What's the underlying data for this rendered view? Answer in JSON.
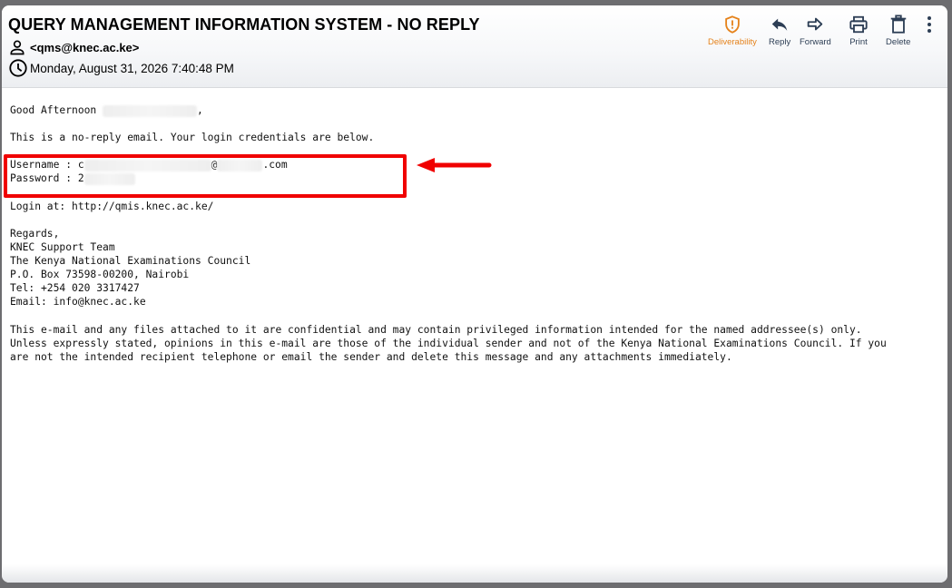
{
  "email": {
    "subject": "QUERY MANAGEMENT INFORMATION SYSTEM - NO REPLY",
    "sender": "<qms@knec.ac.ke>",
    "date": "Monday, August 31, 2026 7:40:48 PM"
  },
  "toolbar": {
    "deliverability": "Deliverability",
    "reply": "Reply",
    "forward": "Forward",
    "print": "Print",
    "delete": "Delete"
  },
  "body": {
    "greeting": "Good Afternoon",
    "greeting_suffix": ",",
    "intro": "This is a no-reply email. Your login credentials are below.",
    "username_label": "Username : c",
    "username_at": "@",
    "username_domain": ".com",
    "password_label": "Password : 2",
    "login": "Login at: http://qmis.knec.ac.ke/",
    "regards": "Regards,",
    "team": "KNEC Support Team",
    "org": "The Kenya National Examinations Council",
    "po_box": "P.O. Box 73598-00200, Nairobi",
    "tel": "Tel: +254 020 3317427",
    "email": "Email: info@knec.ac.ke",
    "disclaimer": "This e-mail and any files attached to it are confidential and may contain privileged information intended for the named addressee(s) only.\nUnless expressly stated, opinions in this e-mail are those of the individual sender and not of the Kenya National Examinations Council. If you\nare not the intended recipient telephone or email the sender and delete this message and any attachments immediately."
  },
  "colors": {
    "annotation_red": "#f00000",
    "deliverability_orange": "#e5821b",
    "toolbar_icon": "#2d3e55"
  }
}
